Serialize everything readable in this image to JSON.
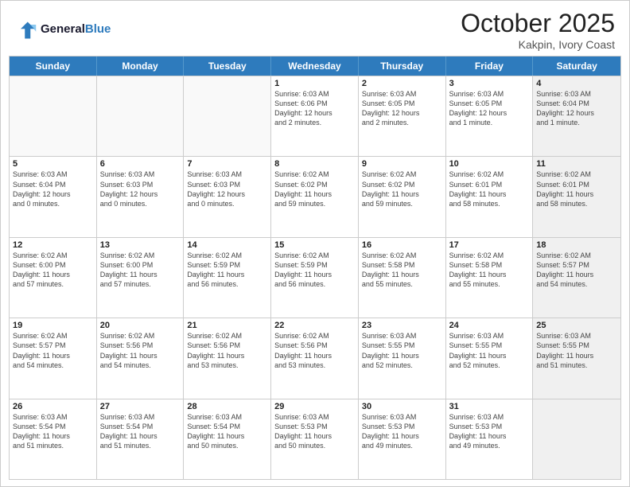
{
  "header": {
    "logo_line1": "General",
    "logo_line2": "Blue",
    "month": "October 2025",
    "location": "Kakpin, Ivory Coast"
  },
  "weekdays": [
    "Sunday",
    "Monday",
    "Tuesday",
    "Wednesday",
    "Thursday",
    "Friday",
    "Saturday"
  ],
  "rows": [
    [
      {
        "day": "",
        "text": "",
        "empty": true
      },
      {
        "day": "",
        "text": "",
        "empty": true
      },
      {
        "day": "",
        "text": "",
        "empty": true
      },
      {
        "day": "1",
        "text": "Sunrise: 6:03 AM\nSunset: 6:06 PM\nDaylight: 12 hours\nand 2 minutes."
      },
      {
        "day": "2",
        "text": "Sunrise: 6:03 AM\nSunset: 6:05 PM\nDaylight: 12 hours\nand 2 minutes."
      },
      {
        "day": "3",
        "text": "Sunrise: 6:03 AM\nSunset: 6:05 PM\nDaylight: 12 hours\nand 1 minute."
      },
      {
        "day": "4",
        "text": "Sunrise: 6:03 AM\nSunset: 6:04 PM\nDaylight: 12 hours\nand 1 minute.",
        "shaded": true
      }
    ],
    [
      {
        "day": "5",
        "text": "Sunrise: 6:03 AM\nSunset: 6:04 PM\nDaylight: 12 hours\nand 0 minutes."
      },
      {
        "day": "6",
        "text": "Sunrise: 6:03 AM\nSunset: 6:03 PM\nDaylight: 12 hours\nand 0 minutes."
      },
      {
        "day": "7",
        "text": "Sunrise: 6:03 AM\nSunset: 6:03 PM\nDaylight: 12 hours\nand 0 minutes."
      },
      {
        "day": "8",
        "text": "Sunrise: 6:02 AM\nSunset: 6:02 PM\nDaylight: 11 hours\nand 59 minutes."
      },
      {
        "day": "9",
        "text": "Sunrise: 6:02 AM\nSunset: 6:02 PM\nDaylight: 11 hours\nand 59 minutes."
      },
      {
        "day": "10",
        "text": "Sunrise: 6:02 AM\nSunset: 6:01 PM\nDaylight: 11 hours\nand 58 minutes."
      },
      {
        "day": "11",
        "text": "Sunrise: 6:02 AM\nSunset: 6:01 PM\nDaylight: 11 hours\nand 58 minutes.",
        "shaded": true
      }
    ],
    [
      {
        "day": "12",
        "text": "Sunrise: 6:02 AM\nSunset: 6:00 PM\nDaylight: 11 hours\nand 57 minutes."
      },
      {
        "day": "13",
        "text": "Sunrise: 6:02 AM\nSunset: 6:00 PM\nDaylight: 11 hours\nand 57 minutes."
      },
      {
        "day": "14",
        "text": "Sunrise: 6:02 AM\nSunset: 5:59 PM\nDaylight: 11 hours\nand 56 minutes."
      },
      {
        "day": "15",
        "text": "Sunrise: 6:02 AM\nSunset: 5:59 PM\nDaylight: 11 hours\nand 56 minutes."
      },
      {
        "day": "16",
        "text": "Sunrise: 6:02 AM\nSunset: 5:58 PM\nDaylight: 11 hours\nand 55 minutes."
      },
      {
        "day": "17",
        "text": "Sunrise: 6:02 AM\nSunset: 5:58 PM\nDaylight: 11 hours\nand 55 minutes."
      },
      {
        "day": "18",
        "text": "Sunrise: 6:02 AM\nSunset: 5:57 PM\nDaylight: 11 hours\nand 54 minutes.",
        "shaded": true
      }
    ],
    [
      {
        "day": "19",
        "text": "Sunrise: 6:02 AM\nSunset: 5:57 PM\nDaylight: 11 hours\nand 54 minutes."
      },
      {
        "day": "20",
        "text": "Sunrise: 6:02 AM\nSunset: 5:56 PM\nDaylight: 11 hours\nand 54 minutes."
      },
      {
        "day": "21",
        "text": "Sunrise: 6:02 AM\nSunset: 5:56 PM\nDaylight: 11 hours\nand 53 minutes."
      },
      {
        "day": "22",
        "text": "Sunrise: 6:02 AM\nSunset: 5:56 PM\nDaylight: 11 hours\nand 53 minutes."
      },
      {
        "day": "23",
        "text": "Sunrise: 6:03 AM\nSunset: 5:55 PM\nDaylight: 11 hours\nand 52 minutes."
      },
      {
        "day": "24",
        "text": "Sunrise: 6:03 AM\nSunset: 5:55 PM\nDaylight: 11 hours\nand 52 minutes."
      },
      {
        "day": "25",
        "text": "Sunrise: 6:03 AM\nSunset: 5:55 PM\nDaylight: 11 hours\nand 51 minutes.",
        "shaded": true
      }
    ],
    [
      {
        "day": "26",
        "text": "Sunrise: 6:03 AM\nSunset: 5:54 PM\nDaylight: 11 hours\nand 51 minutes."
      },
      {
        "day": "27",
        "text": "Sunrise: 6:03 AM\nSunset: 5:54 PM\nDaylight: 11 hours\nand 51 minutes."
      },
      {
        "day": "28",
        "text": "Sunrise: 6:03 AM\nSunset: 5:54 PM\nDaylight: 11 hours\nand 50 minutes."
      },
      {
        "day": "29",
        "text": "Sunrise: 6:03 AM\nSunset: 5:53 PM\nDaylight: 11 hours\nand 50 minutes."
      },
      {
        "day": "30",
        "text": "Sunrise: 6:03 AM\nSunset: 5:53 PM\nDaylight: 11 hours\nand 49 minutes."
      },
      {
        "day": "31",
        "text": "Sunrise: 6:03 AM\nSunset: 5:53 PM\nDaylight: 11 hours\nand 49 minutes."
      },
      {
        "day": "",
        "text": "",
        "empty": true,
        "shaded": true
      }
    ]
  ]
}
